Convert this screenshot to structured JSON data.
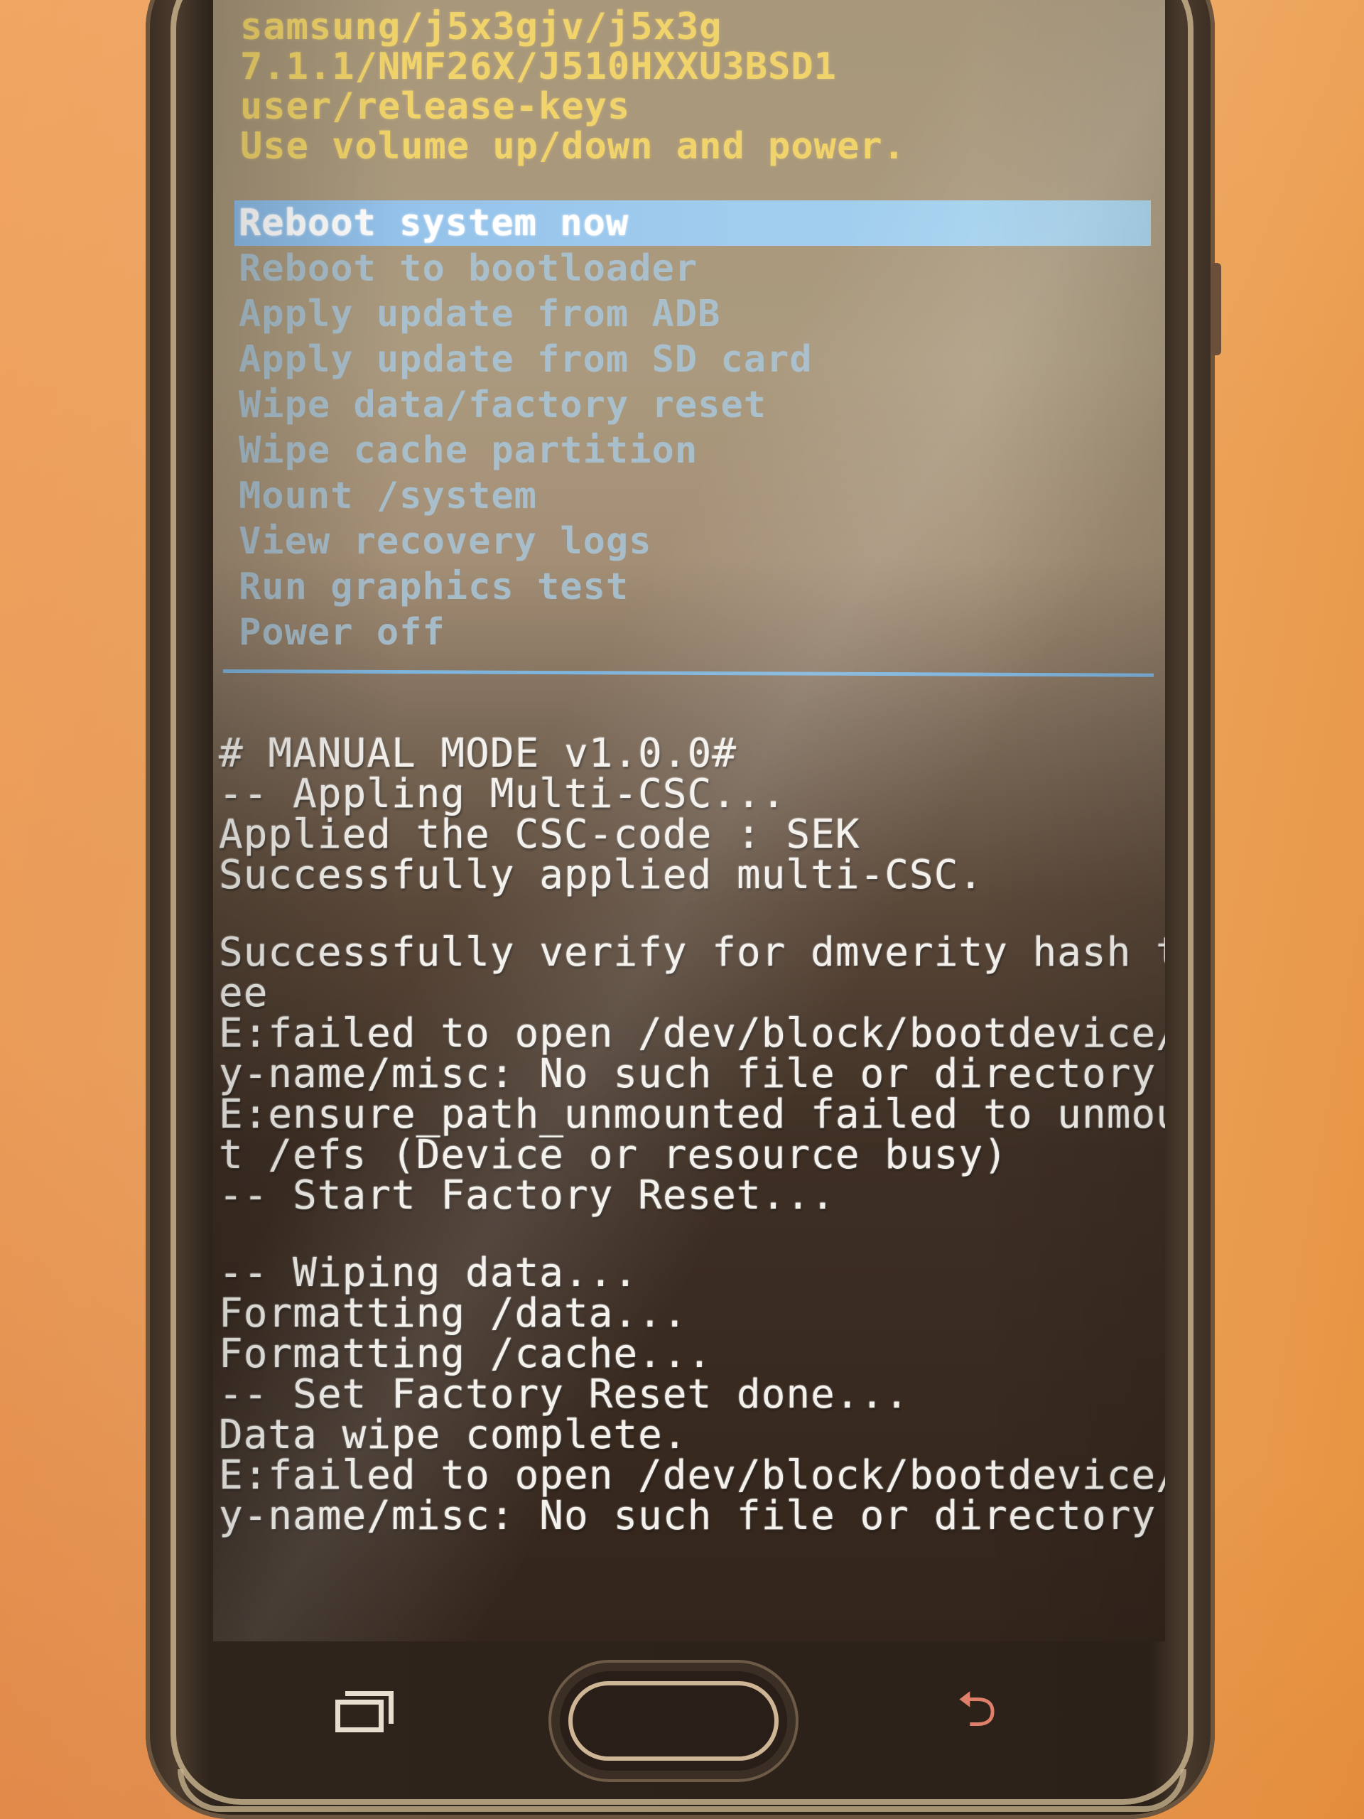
{
  "screen": {
    "type": "android-recovery",
    "colors": {
      "header_text": "#f0d36a",
      "menu_text": "#a9c6d9",
      "selected_bg": "#9fcbee",
      "selected_text": "#ffffff",
      "divider": "#7fb4dc",
      "log_text": "#f4f1ec"
    }
  },
  "header": {
    "lines": [
      "samsung/j5x3gjv/j5x3g",
      "7.1.1/NMF26X/J510HXXU3BSD1",
      "user/release-keys",
      "Use volume up/down and power."
    ]
  },
  "menu": {
    "selected_index": 0,
    "items": [
      {
        "label": "Reboot system now"
      },
      {
        "label": "Reboot to bootloader"
      },
      {
        "label": "Apply update from ADB"
      },
      {
        "label": "Apply update from SD card"
      },
      {
        "label": "Wipe data/factory reset"
      },
      {
        "label": "Wipe cache partition"
      },
      {
        "label": "Mount /system"
      },
      {
        "label": "View recovery logs"
      },
      {
        "label": "Run graphics test"
      },
      {
        "label": "Power off"
      }
    ]
  },
  "log": {
    "lines": [
      "# MANUAL MODE v1.0.0#",
      "-- Appling Multi-CSC...",
      "Applied the CSC-code : SEK",
      "Successfully applied multi-CSC.",
      "",
      "Successfully verify for dmverity hash tr",
      "ee",
      "E:failed to open /dev/block/bootdevice/b",
      "y-name/misc: No such file or directory",
      "E:ensure_path_unmounted failed to unmoun",
      "t /efs (Device or resource busy)",
      "-- Start Factory Reset...",
      "",
      "-- Wiping data...",
      "Formatting /data...",
      "Formatting /cache...",
      "-- Set Factory Reset done...",
      "Data wipe complete.",
      "E:failed to open /dev/block/bootdevice/b",
      "y-name/misc: No such file or directory"
    ]
  },
  "nav": {
    "recents_icon": "recent-apps-icon",
    "home_button": "home-button",
    "back_icon": "back-icon",
    "back_glyph": "⮌"
  }
}
